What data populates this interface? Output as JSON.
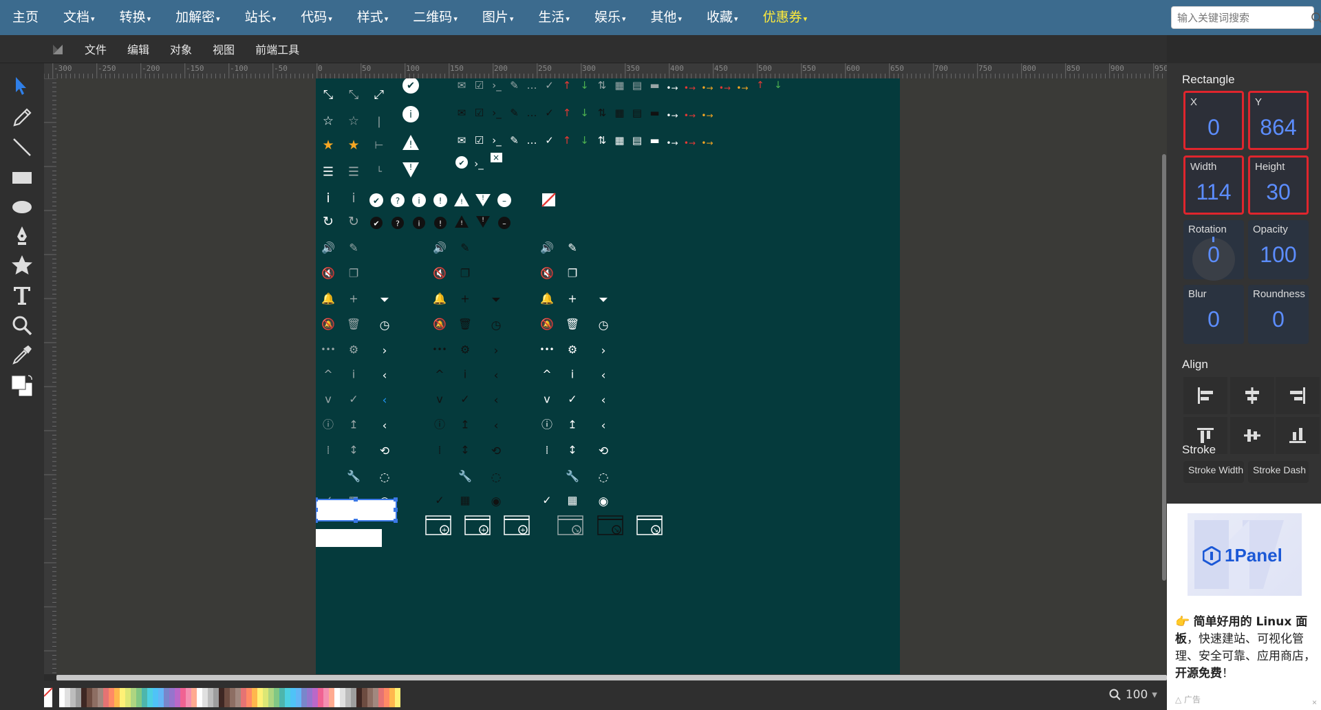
{
  "site_nav": {
    "items": [
      {
        "label": "主页",
        "caret": false
      },
      {
        "label": "文档",
        "caret": true
      },
      {
        "label": "转换",
        "caret": true
      },
      {
        "label": "加解密",
        "caret": true
      },
      {
        "label": "站长",
        "caret": true
      },
      {
        "label": "代码",
        "caret": true
      },
      {
        "label": "样式",
        "caret": true
      },
      {
        "label": "二维码",
        "caret": true
      },
      {
        "label": "图片",
        "caret": true
      },
      {
        "label": "生活",
        "caret": true
      },
      {
        "label": "娱乐",
        "caret": true
      },
      {
        "label": "其他",
        "caret": true
      },
      {
        "label": "收藏",
        "caret": true
      },
      {
        "label": "优惠券",
        "caret": true
      }
    ],
    "highlight_color": "#ffeb3b",
    "search_placeholder": "输入关键词搜索"
  },
  "menubar": {
    "items": [
      "文件",
      "编辑",
      "对象",
      "视图",
      "前端工具"
    ]
  },
  "tools": [
    "select-arrow-icon",
    "pencil-icon",
    "line-icon",
    "rectangle-icon",
    "ellipse-icon",
    "pen-icon",
    "star-icon",
    "text-icon",
    "zoom-icon",
    "eyedropper-icon",
    "color-swatch-icon"
  ],
  "ruler": {
    "top_labels": [
      "-300",
      "-250",
      "-200",
      "-150",
      "-100",
      "-50",
      "0",
      "50",
      "100",
      "150",
      "200",
      "250",
      "300",
      "350",
      "400",
      "450",
      "500",
      "550",
      "600",
      "650",
      "700",
      "750",
      "800",
      "850",
      "900",
      "950"
    ]
  },
  "canvas": {
    "background": "#053a3c"
  },
  "panel": {
    "shape_title": "Rectangle",
    "x": {
      "label": "X",
      "value": "0"
    },
    "y": {
      "label": "Y",
      "value": "864"
    },
    "width": {
      "label": "Width",
      "value": "114"
    },
    "height": {
      "label": "Height",
      "value": "30"
    },
    "rotation": {
      "label": "Rotation",
      "value": "0"
    },
    "opacity": {
      "label": "Opacity",
      "value": "100"
    },
    "blur": {
      "label": "Blur",
      "value": "0"
    },
    "roundness": {
      "label": "Roundness",
      "value": "0"
    },
    "align_title": "Align",
    "stroke_title": "Stroke",
    "stroke_width_label": "Stroke Width",
    "stroke_dash_label": "Stroke Dash",
    "value_color": "#5c8dff",
    "highlight_border": "#e0252d"
  },
  "zoom": {
    "value": "100"
  },
  "ad": {
    "brand": "1Panel",
    "text_parts": [
      "👉 ",
      "简单好用的 Linux 面板",
      "，快速建站、可视化管理、安全可靠、应用商店，",
      "开源免费",
      "！"
    ],
    "tag": "广告",
    "close": "×"
  }
}
